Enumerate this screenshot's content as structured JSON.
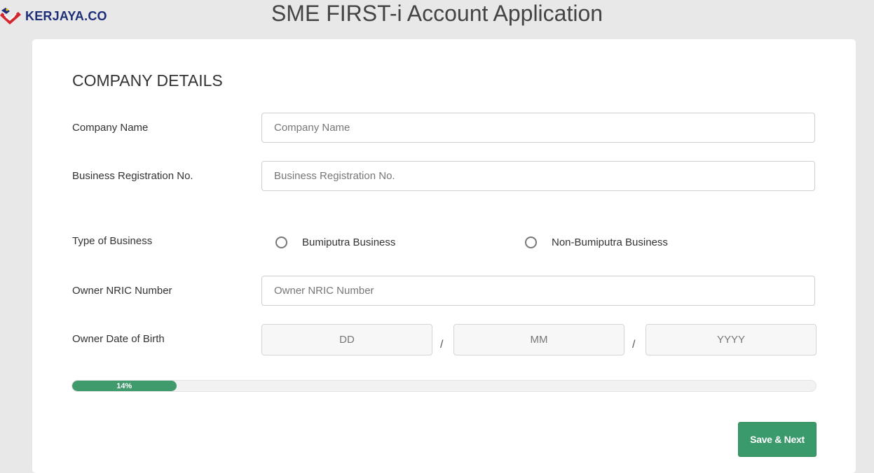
{
  "brand": {
    "logo_text": "KERJAYA.CO"
  },
  "page": {
    "title": "SME FIRST-i Account Application"
  },
  "form": {
    "section_title": "COMPANY DETAILS",
    "company_name": {
      "label": "Company Name",
      "placeholder": "Company Name",
      "value": ""
    },
    "business_reg": {
      "label": "Business Registration No.",
      "placeholder": "Business Registration No.",
      "value": ""
    },
    "business_type": {
      "label": "Type of Business",
      "options": [
        "Bumiputra Business",
        "Non-Bumiputra Business"
      ],
      "selected": null
    },
    "owner_nric": {
      "label": "Owner NRIC Number",
      "placeholder": "Owner NRIC Number",
      "value": ""
    },
    "owner_dob": {
      "label": "Owner Date of Birth",
      "day_placeholder": "DD",
      "month_placeholder": "MM",
      "year_placeholder": "YYYY",
      "separator": "/"
    }
  },
  "progress": {
    "label": "14%",
    "fraction": 0.14
  },
  "actions": {
    "save_next_label": "Save & Next"
  },
  "colors": {
    "accent": "#3a9a6b",
    "brand_blue": "#1c2f78",
    "brand_red": "#d3262e"
  },
  "icons": {
    "logo": "malaysia-flag-heart-icon",
    "radio": "radio-unchecked-icon"
  }
}
